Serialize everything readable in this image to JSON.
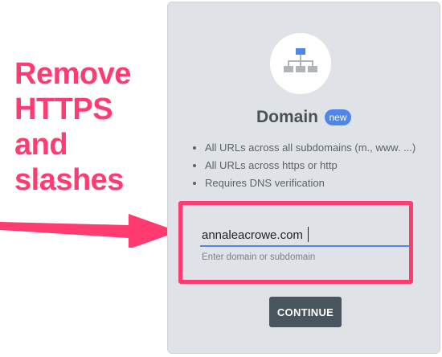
{
  "annotation": {
    "lines": [
      "Remove",
      "HTTPS",
      "and",
      "slashes"
    ]
  },
  "card": {
    "icon": "sitemap-icon",
    "title": "Domain",
    "badge": "new",
    "bullets": [
      "All URLs across all subdomains (m., www. ...)",
      "All URLs across https or http",
      "Requires DNS verification"
    ],
    "input": {
      "value": "annaleacrowe.com",
      "helper": "Enter domain or subdomain"
    },
    "continue_label": "CONTINUE"
  },
  "colors": {
    "accent_pink": "#ff3b72",
    "badge_blue": "#4e86ec",
    "card_bg": "#dfe3e8",
    "button_bg": "#48545e"
  }
}
